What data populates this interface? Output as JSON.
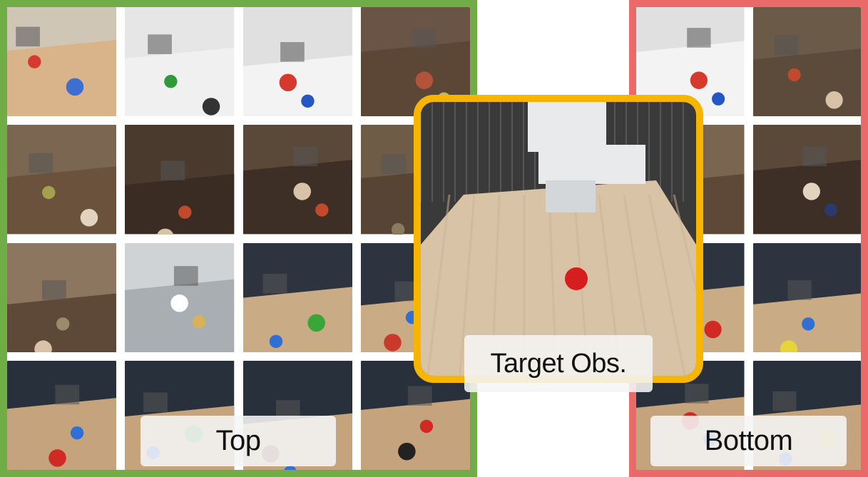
{
  "labels": {
    "top": "Top",
    "bottom": "Bottom",
    "target": "Target Obs."
  },
  "colors": {
    "top_border": "#70ad47",
    "bottom_border": "#ea6a6a",
    "target_border": "#f7b500"
  },
  "top_tiles": [
    {
      "scene": "lab-robot-red-basket",
      "bg": "#cfc6b5",
      "table": "#d9b48a",
      "objects": [
        "#d63a2f",
        "#3c6fd0"
      ]
    },
    {
      "scene": "white-table-green-cup",
      "bg": "#e6e6e6",
      "table": "#f0f0f0",
      "objects": [
        "#2e9a3a",
        "#333333"
      ]
    },
    {
      "scene": "white-table-blue-bowl",
      "bg": "#e0e0e0",
      "table": "#f3f3f3",
      "objects": [
        "#2456c4",
        "#d63a2f"
      ]
    },
    {
      "scene": "dark-table-snacks",
      "bg": "#6a5445",
      "table": "#5c4636",
      "objects": [
        "#c8b45a",
        "#b3543a"
      ]
    },
    {
      "scene": "arm-over-wood",
      "bg": "#7b6651",
      "table": "#6b523c",
      "objects": [
        "#a3a14d",
        "#e2d2c0"
      ]
    },
    {
      "scene": "dark-table-apple",
      "bg": "#4a3a2e",
      "table": "#3a2c22",
      "objects": [
        "#c24a2c",
        "#d9c3a8"
      ]
    },
    {
      "scene": "dark-table-arm-apple",
      "bg": "#5a4838",
      "table": "#3d2f25",
      "objects": [
        "#c24a2c",
        "#d9c3a8"
      ]
    },
    {
      "scene": "shelf-scene",
      "bg": "#6f5c47",
      "table": "#574434",
      "objects": [
        "#8c7a5c",
        "#d9c3a8"
      ]
    },
    {
      "scene": "drawer-cabinet",
      "bg": "#8c7660",
      "table": "#5e4837",
      "objects": [
        "#9c8a6c",
        "#d9c3a8"
      ]
    },
    {
      "scene": "kitchen-sink",
      "bg": "#cfd3d6",
      "table": "#a8aeb2",
      "objects": [
        "#d6b25a",
        "#ffffff"
      ]
    },
    {
      "scene": "blue-bin-green-cup",
      "bg": "#2d3440",
      "table": "#c9ab86",
      "objects": [
        "#2f6fd6",
        "#3aa63a"
      ]
    },
    {
      "scene": "blue-bin-red-ball",
      "bg": "#2d3440",
      "table": "#c9ab86",
      "objects": [
        "#2f6fd6",
        "#c93a2a"
      ]
    },
    {
      "scene": "stove-blue-bin-red-ball",
      "bg": "#28303b",
      "table": "#c4a37d",
      "objects": [
        "#2f6fd6",
        "#d12a24"
      ]
    },
    {
      "scene": "stove-green-cup",
      "bg": "#28303b",
      "table": "#c4a37d",
      "objects": [
        "#2f6fd6",
        "#3aa63a"
      ]
    },
    {
      "scene": "stove-blue-bowl",
      "bg": "#28303b",
      "table": "#c4a37d",
      "objects": [
        "#2f6fd6",
        "#7a3a2a"
      ]
    },
    {
      "scene": "stove-red-ball-bowl",
      "bg": "#28303b",
      "table": "#c4a37d",
      "objects": [
        "#d12a24",
        "#222222"
      ]
    }
  ],
  "bottom_tiles": [
    {
      "scene": "white-table-blue-bowl",
      "bg": "#e0e0e0",
      "table": "#f3f3f3",
      "objects": [
        "#2456c4",
        "#d63a2f"
      ]
    },
    {
      "scene": "dark-cabinet-apple",
      "bg": "#6b5a48",
      "table": "#5c4a3a",
      "objects": [
        "#c24a2c",
        "#d9c3a8"
      ]
    },
    {
      "scene": "arm-shelf",
      "bg": "#7a6550",
      "table": "#5e4837",
      "objects": [
        "#e2d2c0",
        "#9c8a6c"
      ]
    },
    {
      "scene": "arm-snack-bag",
      "bg": "#5a4838",
      "table": "#3d2f25",
      "objects": [
        "#2a3a6a",
        "#e2d2c0"
      ]
    },
    {
      "scene": "blue-bin-scene",
      "bg": "#2d3440",
      "table": "#c9ab86",
      "objects": [
        "#2f6fd6",
        "#d12a24"
      ]
    },
    {
      "scene": "blue-bin-yellow-cup",
      "bg": "#2d3440",
      "table": "#c9ab86",
      "objects": [
        "#2f6fd6",
        "#e6d43a"
      ]
    },
    {
      "scene": "stove-blue-bin",
      "bg": "#28303b",
      "table": "#c4a37d",
      "objects": [
        "#2f6fd6",
        "#d12a24"
      ]
    },
    {
      "scene": "stove-yellow-cup",
      "bg": "#28303b",
      "table": "#c4a37d",
      "objects": [
        "#2f6fd6",
        "#d6b23a"
      ]
    }
  ],
  "target": {
    "scene": "gripper-over-wood-table-red-ball",
    "bg": "#3a3a3a",
    "table": "#d8c3a6",
    "ball": "#d61e1e",
    "gripper": "#e8eaec"
  }
}
